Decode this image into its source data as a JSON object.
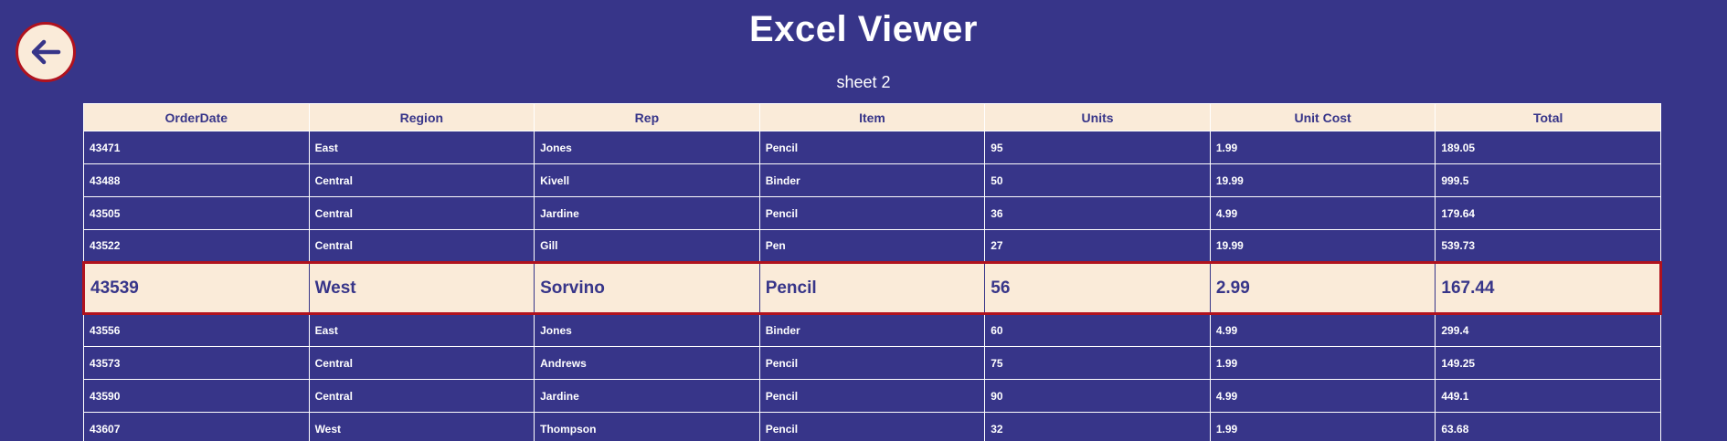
{
  "header": {
    "title": "Excel Viewer",
    "sheet_name": "sheet 2",
    "back_icon": "arrow-left-icon"
  },
  "colors": {
    "background": "#373589",
    "header_bg": "#faebd9",
    "accent_red": "#b0121e",
    "text_light": "#ffffff"
  },
  "table": {
    "columns": [
      "OrderDate",
      "Region",
      "Rep",
      "Item",
      "Units",
      "Unit Cost",
      "Total"
    ],
    "rows": [
      [
        "43471",
        "East",
        "Jones",
        "Pencil",
        "95",
        "1.99",
        "189.05"
      ],
      [
        "43488",
        "Central",
        "Kivell",
        "Binder",
        "50",
        "19.99",
        "999.5"
      ],
      [
        "43505",
        "Central",
        "Jardine",
        "Pencil",
        "36",
        "4.99",
        "179.64"
      ],
      [
        "43522",
        "Central",
        "Gill",
        "Pen",
        "27",
        "19.99",
        "539.73"
      ],
      [
        "43539",
        "West",
        "Sorvino",
        "Pencil",
        "56",
        "2.99",
        "167.44"
      ],
      [
        "43556",
        "East",
        "Jones",
        "Binder",
        "60",
        "4.99",
        "299.4"
      ],
      [
        "43573",
        "Central",
        "Andrews",
        "Pencil",
        "75",
        "1.99",
        "149.25"
      ],
      [
        "43590",
        "Central",
        "Jardine",
        "Pencil",
        "90",
        "4.99",
        "449.1"
      ],
      [
        "43607",
        "West",
        "Thompson",
        "Pencil",
        "32",
        "1.99",
        "63.68"
      ]
    ],
    "selected_row_index": 4
  }
}
